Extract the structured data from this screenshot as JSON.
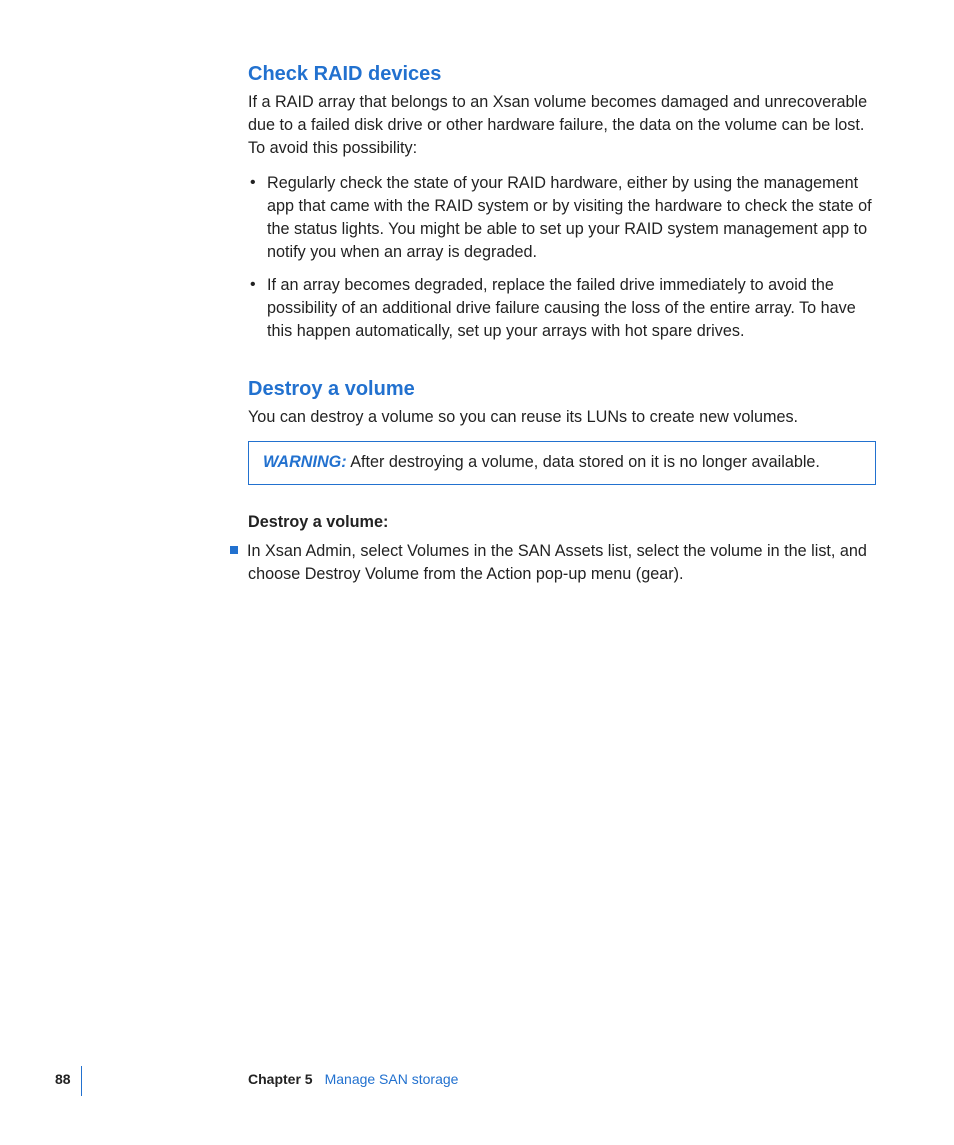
{
  "section1": {
    "title": "Check RAID devices",
    "intro": "If a RAID array that belongs to an Xsan volume becomes damaged and unrecoverable due to a failed disk drive or other hardware failure, the data on the volume can be lost. To avoid this possibility:",
    "items": [
      "Regularly check the state of your RAID hardware, either by using the management app that came with the RAID system or by visiting the hardware to check the state of the status lights. You might be able to set up your RAID system management app to notify you when an array is degraded.",
      "If an array becomes degraded, replace the failed drive immediately to avoid the possibility of an additional drive failure causing the loss of the entire array. To have this happen automatically, set up your arrays with hot spare drives."
    ]
  },
  "section2": {
    "title": "Destroy a volume",
    "intro": "You can destroy a volume so you can reuse its LUNs to create new volumes.",
    "warning_label": "WARNING:",
    "warning_text": "  After destroying a volume, data stored on it is no longer available.",
    "step_title": "Destroy a volume:",
    "step_line1": "In Xsan Admin, select Volumes in the SAN Assets list, select the volume in the list, and",
    "step_line2": "choose Destroy Volume from the Action pop-up menu (gear)."
  },
  "footer": {
    "page": "88",
    "chapter_label": "Chapter 5",
    "chapter_title": "Manage SAN storage"
  }
}
